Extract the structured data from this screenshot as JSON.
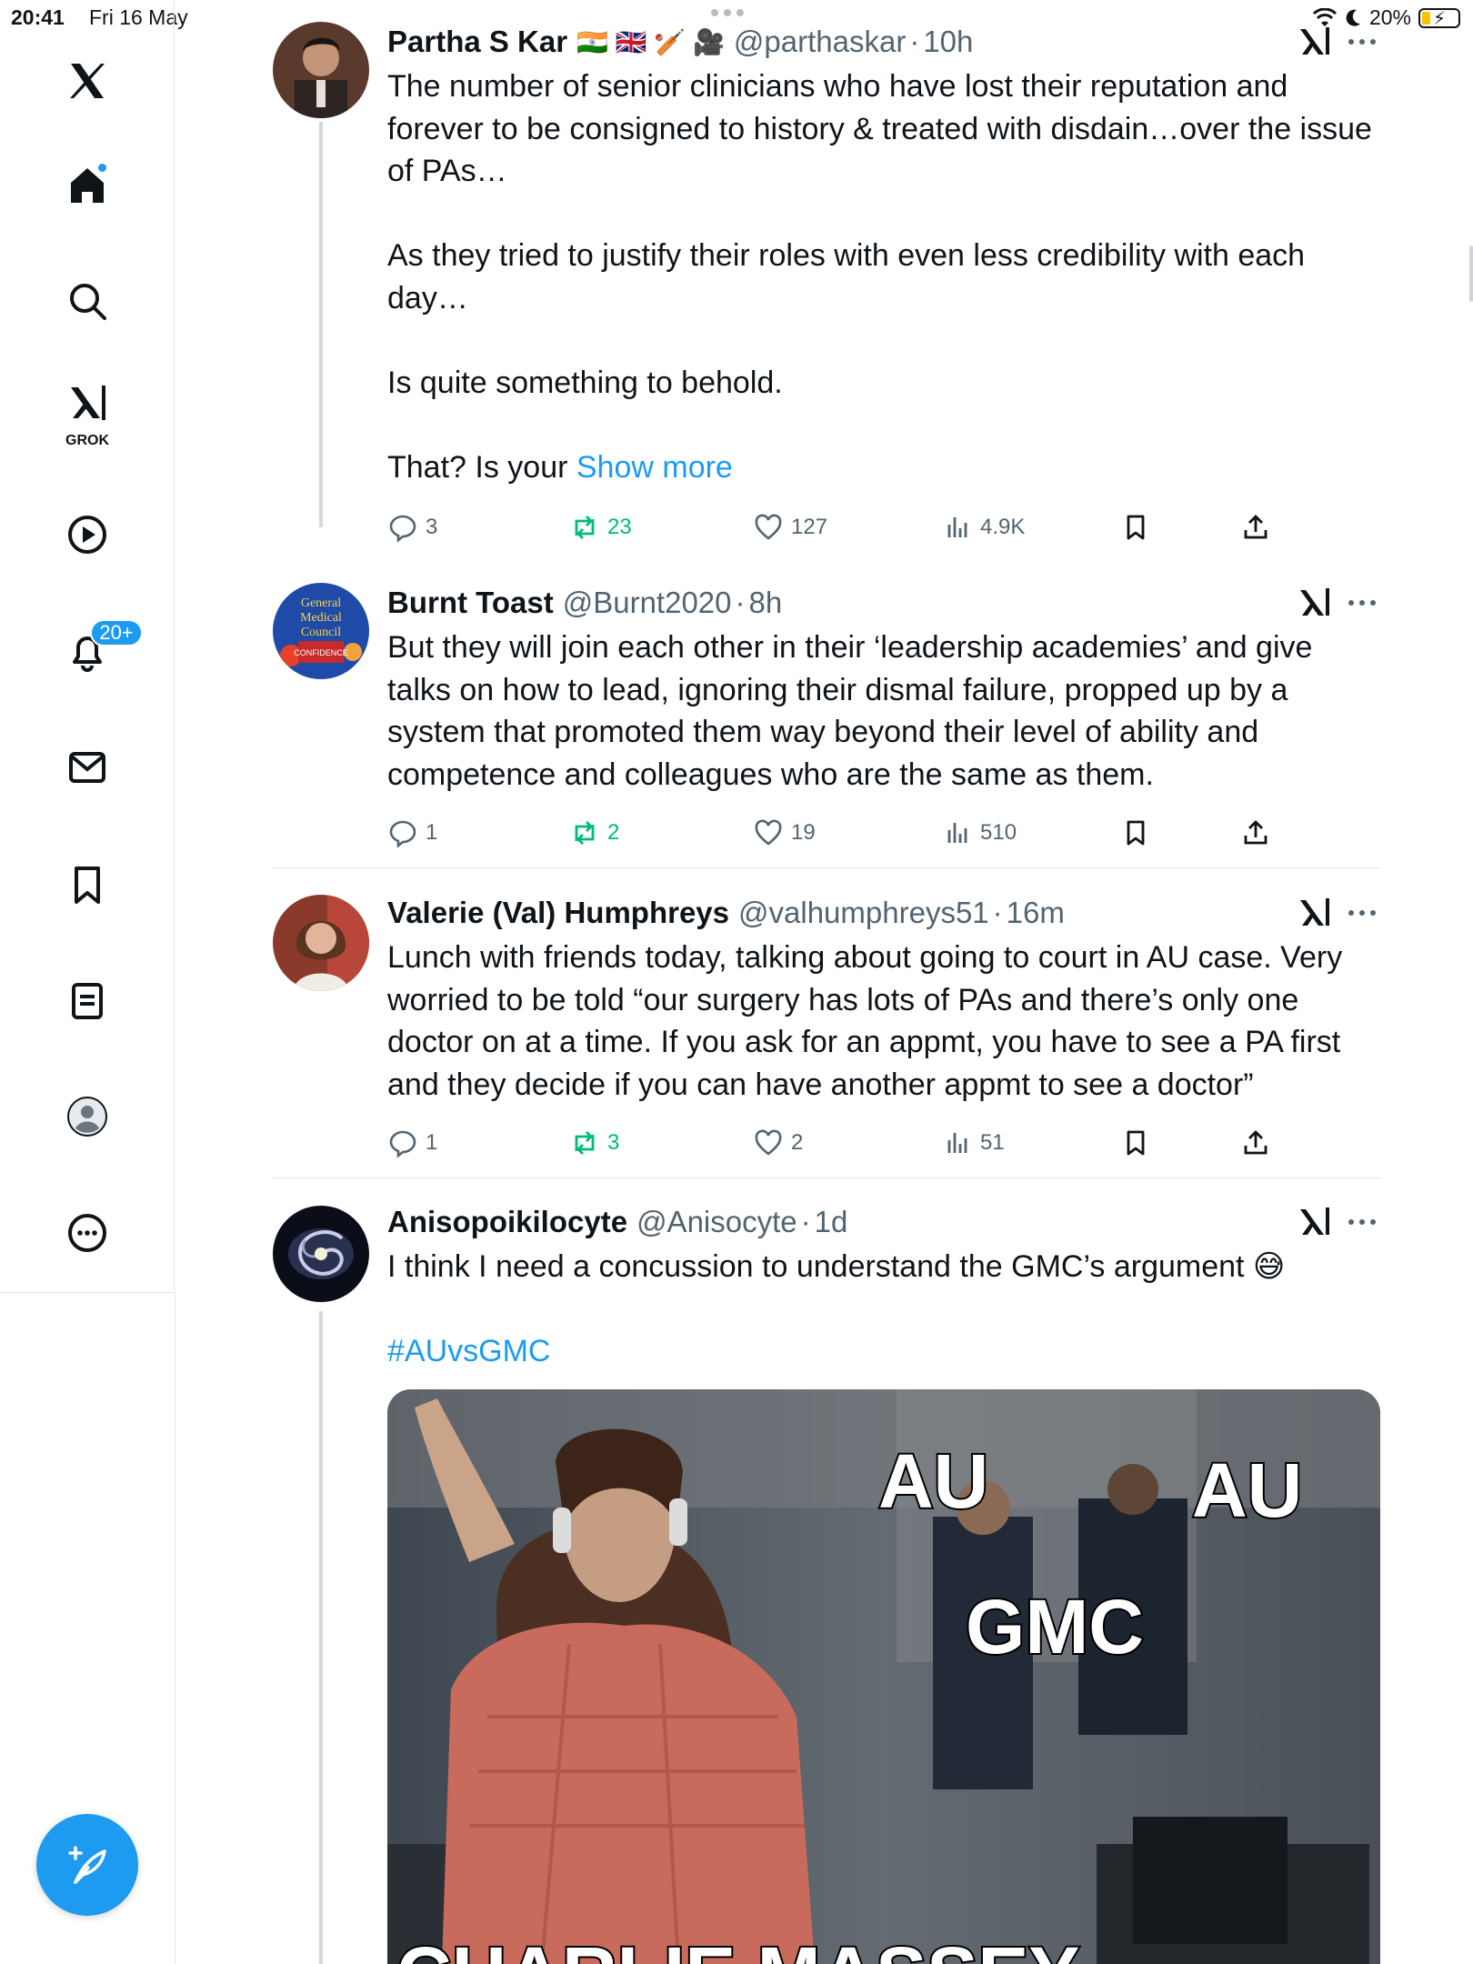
{
  "status_bar": {
    "time": "20:41",
    "date": "Fri 16 May",
    "battery": "20%"
  },
  "sidebar": {
    "grok_label": "GROK",
    "notifications_badge": "20+"
  },
  "tweets": [
    {
      "name": "Partha S Kar",
      "flags": "🇮🇳 🇬🇧 🏏 🎥",
      "handle": "@parthaskar",
      "time": "10h",
      "text": "The number of senior clinicians who have lost their reputation and forever to be consigned to history & treated with disdain…over the issue of PAs…\n\nAs they tried to justify their roles with even less credibility with each day…\n\nIs quite something to behold.\n\nThat? Is your ",
      "show_more": "Show more",
      "replies": "3",
      "reposts": "23",
      "likes": "127",
      "views": "4.9K"
    },
    {
      "name": "Burnt Toast",
      "handle": "@Burnt2020",
      "time": "8h",
      "text": "But they will join each other in their ‘leadership academies’ and give talks on how to lead, ignoring their dismal failure, propped up by a system that promoted them way beyond their level of ability and competence and colleagues who are the same as them.",
      "replies": "1",
      "reposts": "2",
      "likes": "19",
      "views": "510",
      "avatar_text": [
        "General",
        "Medical",
        "Council",
        "CONFIDENCE"
      ]
    },
    {
      "name": "Valerie (Val) Humphreys",
      "handle": "@valhumphreys51",
      "time": "16m",
      "text": "Lunch with friends today, talking about going to court in AU case. Very worried to be told “our surgery has lots of PAs and there’s only one doctor on at a time. If you ask for an appmt, you have to see a PA first and they decide if you can have another appmt to see a doctor”",
      "replies": "1",
      "reposts": "3",
      "likes": "2",
      "views": "51"
    },
    {
      "name": "Anisopoikilocyte",
      "handle": "@Anisocyte",
      "time": "1d",
      "text": "I think I need a concussion to understand the GMC’s argument 😅",
      "hashtag": "#AUvsGMC",
      "media_labels": {
        "au_left": "AU",
        "au_right": "AU",
        "gmc": "GMC",
        "bottom": "CHARLIE MASSEY"
      }
    }
  ],
  "colors": {
    "accent": "#1d9bf0",
    "repost": "#00ba7c",
    "muted": "#536471"
  }
}
